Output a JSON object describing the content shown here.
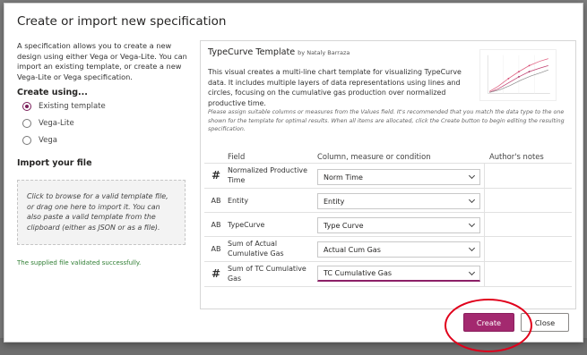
{
  "dialog": {
    "title": "Create or import new specification"
  },
  "left": {
    "intro": "A specification allows you to create a new design using either Vega or Vega-Lite. You can import an existing template, or create a new Vega-Lite or Vega specification.",
    "create_using_label": "Create using...",
    "options": [
      {
        "label": "Existing template",
        "selected": true
      },
      {
        "label": "Vega-Lite",
        "selected": false
      },
      {
        "label": "Vega",
        "selected": false
      }
    ],
    "import_label": "Import your file",
    "dropzone_text": "Click to browse for a valid template file, or drag one here to import it. You can also paste a valid template from the clipboard (either as JSON or as a file).",
    "validated_text": "The supplied file validated successfully."
  },
  "template": {
    "name": "TypeCurve Template",
    "author": "by Nataly Barraza",
    "description": "This visual creates a multi-line chart template for visualizing TypeCurve data. It includes multiple layers of data representations using lines and circles, focusing on the cumulative gas production over normalized productive time.",
    "note": "Please assign suitable columns or measures from the Values field. It's recommended that you match the data type to the one shown for the template for optimal results. When all items are allocated, click the Create button to begin editing the resulting specification."
  },
  "table": {
    "headers": {
      "field": "Field",
      "column": "Column, measure or condition",
      "notes": "Author's notes"
    },
    "rows": [
      {
        "type_icon": "#",
        "field": "Normalized Productive Time",
        "value": "Norm Time"
      },
      {
        "type_icon": "AB",
        "field": "Entity",
        "value": "Entity"
      },
      {
        "type_icon": "AB",
        "field": "TypeCurve",
        "value": "Type Curve"
      },
      {
        "type_icon": "AB",
        "field": "Sum of Actual Cumulative Gas",
        "value": "Actual Cum Gas"
      },
      {
        "type_icon": "#",
        "field": "Sum of TC Cumulative Gas",
        "value": "TC Cumulative Gas"
      }
    ]
  },
  "buttons": {
    "create": "Create",
    "close": "Close"
  },
  "colors": {
    "accent": "#a3296f",
    "annotation": "#e0001b",
    "success": "#2e7d32"
  }
}
